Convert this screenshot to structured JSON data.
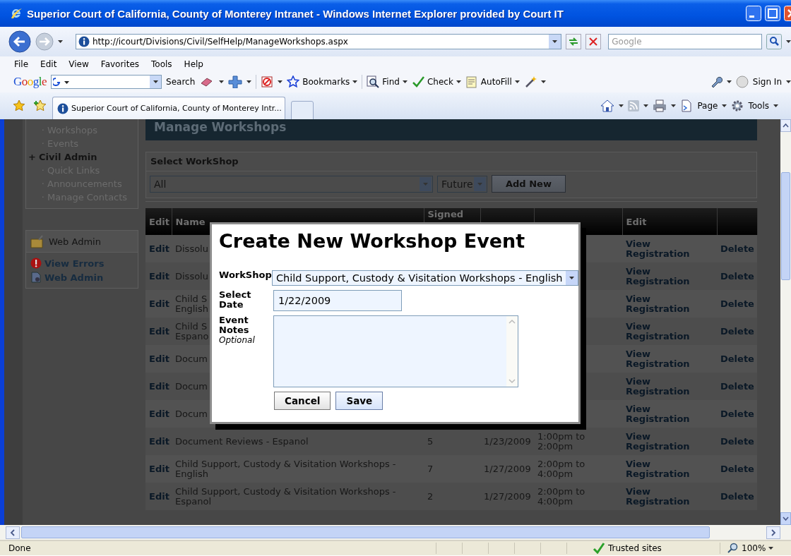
{
  "window": {
    "title": "Superior Court of California, County of Monterey Intranet - Windows Internet Explorer provided by Court IT"
  },
  "address_bar": {
    "url": "http://icourt/Divisions/Civil/SelfHelp/ManageWorkshops.aspx"
  },
  "search_box": {
    "placeholder": "Google"
  },
  "menu": [
    "File",
    "Edit",
    "View",
    "Favorites",
    "Tools",
    "Help"
  ],
  "google_toolbar": {
    "logo": "Google",
    "search_label": "Search",
    "items": [
      "Bookmarks",
      "Find",
      "Check",
      "AutoFill"
    ],
    "sign_in": "Sign In"
  },
  "tabs": [
    {
      "label": "Superior Court of California, County of Monterey Intr...",
      "selected": true
    }
  ],
  "command_bar": [
    "Page",
    "Tools"
  ],
  "sidebar": {
    "items": [
      {
        "marker": "·",
        "label": "Workshops",
        "kind": "link"
      },
      {
        "marker": "·",
        "label": "Events",
        "kind": "link"
      },
      {
        "marker": "+",
        "label": "Civil Admin",
        "kind": "section"
      },
      {
        "marker": "·",
        "label": "Quick Links",
        "kind": "link"
      },
      {
        "marker": "·",
        "label": "Announcements",
        "kind": "link"
      },
      {
        "marker": "·",
        "label": "Manage Contacts",
        "kind": "link"
      }
    ]
  },
  "web_admin": {
    "title": "Web Admin",
    "links": [
      {
        "label": "View Errors",
        "kind": "errors"
      },
      {
        "label": "Web Admin",
        "kind": "page"
      }
    ]
  },
  "page_title": "Manage Workshops",
  "filter": {
    "title": "Select WorkShop",
    "workshop": "All",
    "period": "Future",
    "add_button": "Add New"
  },
  "table": {
    "columns": [
      {
        "label": "Edit"
      },
      {
        "label": "Name"
      },
      {
        "label": "Signed"
      },
      {},
      {},
      {
        "label": "Edit"
      },
      {}
    ],
    "rows": [
      {
        "edit": "Edit",
        "name": "Dissolu",
        "registration": "View Registration",
        "delete": "Delete"
      },
      {
        "edit": "Edit",
        "name": "Dissolu",
        "registration": "View Registration",
        "delete": "Delete"
      },
      {
        "edit": "Edit",
        "name": "Child S\nEnglish",
        "registration": "View Registration",
        "delete": "Delete"
      },
      {
        "edit": "Edit",
        "name": "Child S\nEspano",
        "registration": "View Registration",
        "delete": "Delete"
      },
      {
        "edit": "Edit",
        "name": "Docum",
        "registration": "View Registration",
        "delete": "Delete"
      },
      {
        "edit": "Edit",
        "name": "Docum",
        "registration": "View Registration",
        "delete": "Delete"
      },
      {
        "edit": "Edit",
        "name": "Docum",
        "registration": "View Registration",
        "delete": "Delete"
      },
      {
        "edit": "Edit",
        "name": "Document Reviews - Espanol",
        "signed": "5",
        "column_4": "1/23/2009",
        "column_5": "1:00pm to 2:00pm",
        "registration": "View Registration",
        "delete": "Delete"
      },
      {
        "edit": "Edit",
        "name": "Child Support, Custody & Visitation Workshops - English",
        "signed": "7",
        "column_4": "1/27/2009",
        "column_5": "2:00pm to 4:00pm",
        "registration": "View Registration",
        "delete": "Delete"
      },
      {
        "edit": "Edit",
        "name": "Child Support, Custody & Visitation Workshops - Espanol",
        "signed": "2",
        "column_4": "1/27/2009",
        "column_5": "2:00pm to 4:00pm",
        "registration": "View Registration",
        "delete": "Delete"
      }
    ]
  },
  "dialog": {
    "title": "Create New Workshop Event",
    "fields": [
      {
        "kind": "select",
        "label": "WorkShop",
        "value": "Child Support, Custody & Visitation Workshops - English"
      },
      {
        "kind": "text",
        "label": "Select Date",
        "value": "1/22/2009"
      },
      {
        "kind": "textarea",
        "label": "Event Notes",
        "hint": "Optional"
      }
    ],
    "buttons": [
      "Cancel",
      "Save"
    ]
  },
  "status_bar": {
    "text": "Done",
    "zone": "Trusted sites",
    "zoom": "100%"
  }
}
